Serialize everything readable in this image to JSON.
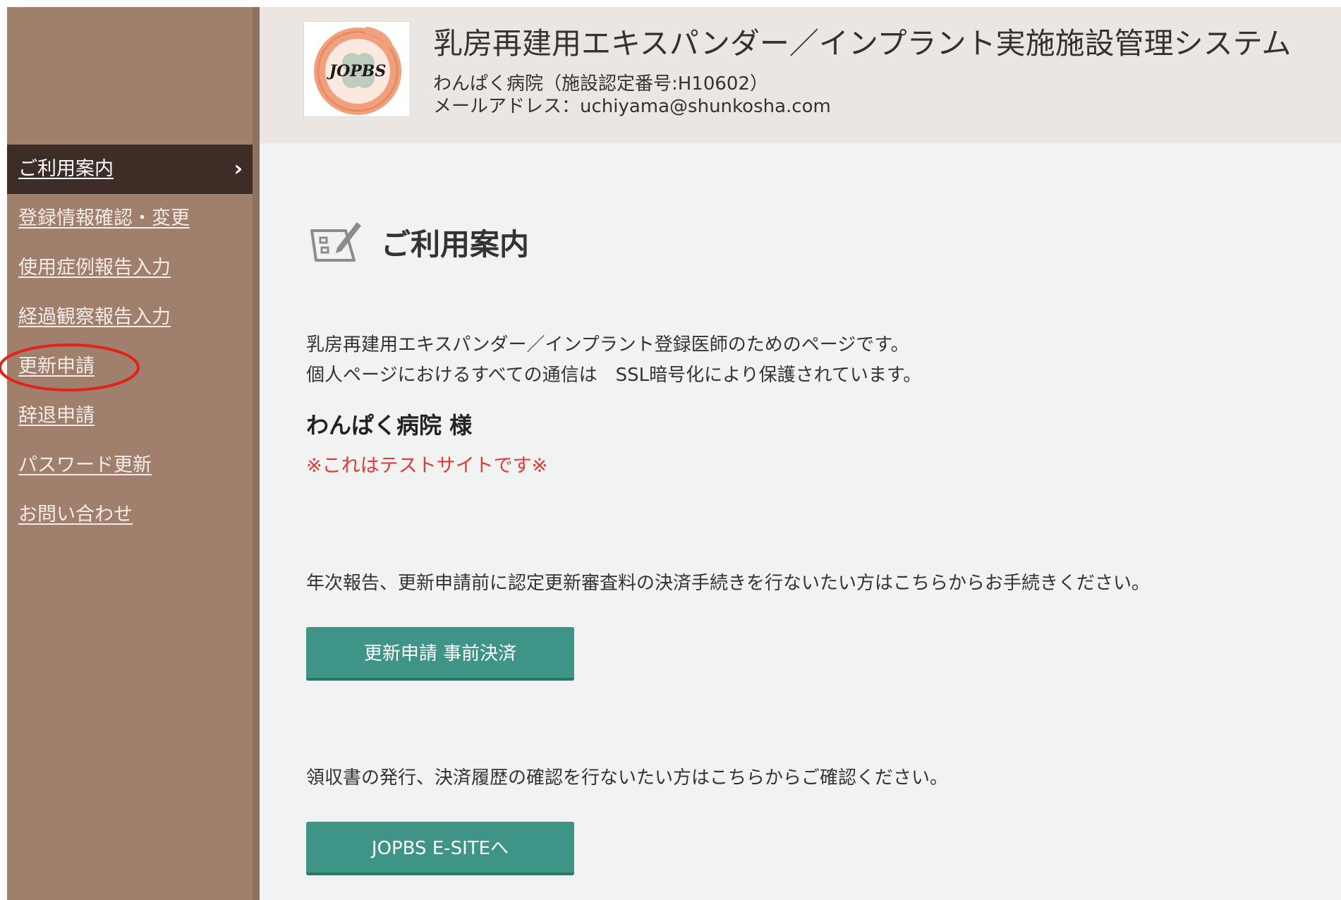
{
  "header": {
    "system_title": "乳房再建用エキスパンダー／インプラント実施施設管理システム",
    "facility": "わんぱく病院（施設認定番号:H10602）",
    "email": "メールアドレス：uchiyama@shunkosha.com",
    "logo_text": "JOPBS"
  },
  "sidebar": {
    "items": [
      {
        "label": "ご利用案内",
        "active": true
      },
      {
        "label": "登録情報確認・変更",
        "active": false
      },
      {
        "label": "使用症例報告入力",
        "active": false
      },
      {
        "label": "経過観察報告入力",
        "active": false
      },
      {
        "label": "更新申請",
        "active": false
      },
      {
        "label": "辞退申請",
        "active": false
      },
      {
        "label": "パスワード更新",
        "active": false
      },
      {
        "label": "お問い合わせ",
        "active": false
      }
    ],
    "active_indicator": "›"
  },
  "main": {
    "page_title": "ご利用案内",
    "intro_lines": [
      "乳房再建用エキスパンダー／インプラント登録医師のためのページです。",
      "個人ページにおけるすべての通信は　SSL暗号化により保護されています。"
    ],
    "greeting": "わんぱく病院 様",
    "test_notice": "※これはテストサイトです※",
    "payment_text": "年次報告、更新申請前に認定更新審査料の決済手続きを行ないたい方はこちらからお手続きください。",
    "payment_button": "更新申請 事前決済",
    "receipt_text": "領収書の発行、決済履歴の確認を行ないたい方はこちらからご確認ください。",
    "esite_button": "JOPBS E-SITEへ"
  },
  "colors": {
    "sidebar_bg": "#a07f6c",
    "sidebar_active": "#3e2c27",
    "header_bg": "#ebe6e2",
    "main_bg": "#f1f3f2",
    "button_teal": "#3e9486",
    "notice_red": "#e53935",
    "annotation_red": "#e2231a"
  }
}
